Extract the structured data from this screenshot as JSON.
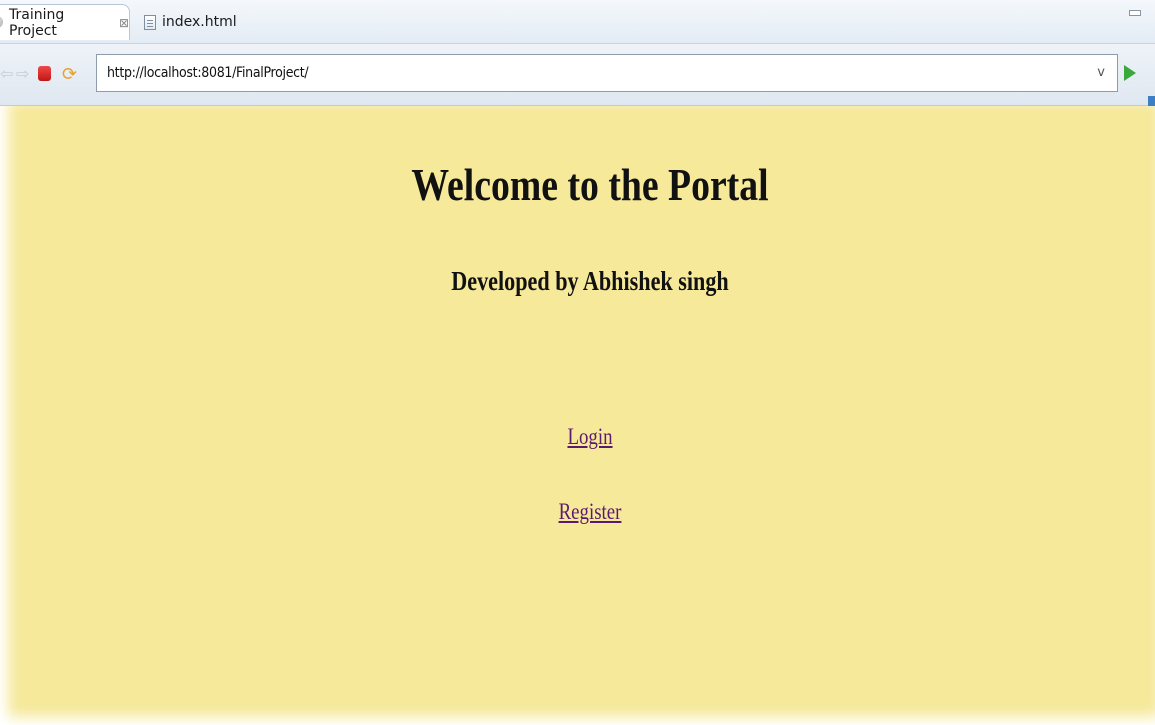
{
  "tabs": [
    {
      "label": "Training Project",
      "close_glyph": "⊠",
      "active": true,
      "icon": "globe-icon"
    },
    {
      "label": "index.html",
      "active": false,
      "icon": "file-icon"
    }
  ],
  "toolbar": {
    "url": "http://localhost:8081/FinalProject/",
    "dropdown_glyph": "v",
    "back_glyph": "⇦",
    "forward_glyph": "⇨",
    "refresh_glyph": "⟳"
  },
  "page": {
    "background_color": "#f6e99a",
    "heading": "Welcome to the Portal",
    "subheading": "Developed by Abhishek singh",
    "links": {
      "login": "Login",
      "register": "Register"
    },
    "link_color": "#5b1a6e"
  }
}
